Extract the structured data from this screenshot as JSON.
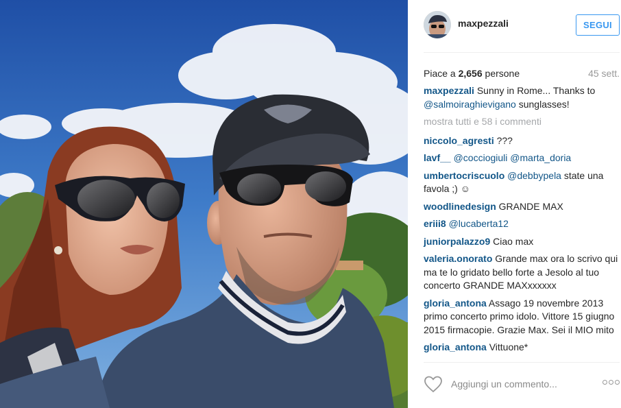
{
  "header": {
    "username": "maxpezzali",
    "follow_label": "SEGUI"
  },
  "stats": {
    "likes_prefix": "Piace a",
    "likes_count": "2,656",
    "likes_suffix": "persone",
    "time_ago": "45 sett."
  },
  "caption": {
    "user": "maxpezzali",
    "text_1": "Sunny in Rome... Thanks to",
    "mention": "@salmoiraghievigano",
    "text_2": "sunglasses!"
  },
  "show_all_label": "mostra tutti e 58 i commenti",
  "comments": [
    {
      "user": "niccolo_agresti",
      "text": "???"
    },
    {
      "user": "lavf__",
      "mention_1": "@cocciogiuli",
      "mention_2": "@marta_doria"
    },
    {
      "user": "umbertocriscuolo",
      "mention": "@debbypela",
      "text": "state una favola ;) ☺"
    },
    {
      "user": "woodlinedesign",
      "text": "GRANDE MAX"
    },
    {
      "user": "eriii8",
      "mention": "@lucaberta12"
    },
    {
      "user": "juniorpalazzo9",
      "text": "Ciao max"
    },
    {
      "user": "valeria.onorato",
      "text": "Grande max ora lo scrivo qui ma te lo gridato bello forte a Jesolo al tuo concerto GRANDE MAXxxxxxx"
    },
    {
      "user": "gloria_antona",
      "text": "Assago 19 novembre 2013 primo concerto primo idolo. Vittore 15 giugno 2015 firmacopie. Grazie Max. Sei il MIO mito"
    },
    {
      "user": "gloria_antona",
      "text": "Vittuone*"
    }
  ],
  "footer": {
    "comment_placeholder": "Aggiungi un commento...",
    "more_icon": "more-dots-icon",
    "like_icon": "heart-icon"
  },
  "colors": {
    "link_blue": "#125688",
    "follow_blue": "#3897f0",
    "muted": "#999999"
  }
}
